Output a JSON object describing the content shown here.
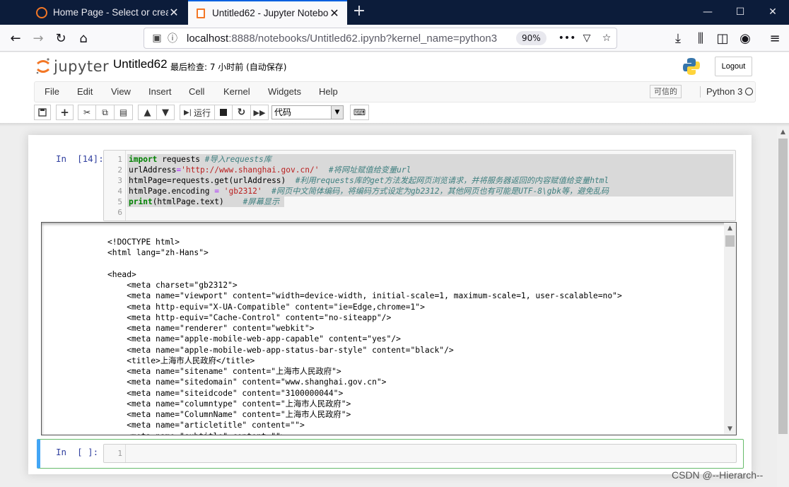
{
  "browser": {
    "tabs": [
      {
        "title": "Home Page - Select or create",
        "active": false,
        "icon": "jupyter-icon"
      },
      {
        "title": "Untitled62 - Jupyter Notebook",
        "active": true,
        "icon": "jupyter-icon"
      }
    ],
    "url_host": "localhost",
    "url_rest": ":8888/notebooks/Untitled62.ipynb?kernel_name=python3",
    "zoom": "90%"
  },
  "jupyter": {
    "logo_text": "jupyter",
    "notebook_title": "Untitled62",
    "checkpoint": "最后检查: 7 小时前  (自动保存)",
    "logout_label": "Logout",
    "menu": [
      "File",
      "Edit",
      "View",
      "Insert",
      "Cell",
      "Kernel",
      "Widgets",
      "Help"
    ],
    "trusted_label": "可信的",
    "kernel_name": "Python 3",
    "toolbar": {
      "run_label": "运行",
      "cell_type": "代码"
    }
  },
  "cell1": {
    "prompt": "In  [14]:",
    "line_numbers": [
      "1",
      "2",
      "3",
      "4",
      "5",
      "6"
    ]
  },
  "code": {
    "l1_kw": "import",
    "l1_mod": " requests ",
    "l1_cm": "#导入requests库",
    "l2_var": "urlAddress",
    "l2_eq": "=",
    "l2_str": "'http://www.shanghai.gov.cn/'",
    "l2_cm": "  #将网址赋值给变量url",
    "l3_code": "htmlPage=requests.get(urlAddress)",
    "l3_cm": "  #利用requests库的get方法发起网页浏览请求，并将服务器返回的内容赋值给变量html",
    "l4_code": "htmlPage.encoding ",
    "l4_eq": "=",
    "l4_str": " 'gb2312'",
    "l4_cm": "  #网页中文简体编码，将编码方式设定为gb2312，其他网页也有可能是UTF-8\\gbk等，避免乱码",
    "l5_kw": "print",
    "l5_code": "(htmlPage.text)",
    "l5_cm": "    #屏幕显示"
  },
  "output_lines": [
    "<!DOCTYPE html>",
    "<html lang=\"zh-Hans\">",
    "",
    "<head>",
    "    <meta charset=\"gb2312\">",
    "    <meta name=\"viewport\" content=\"width=device-width, initial-scale=1, maximum-scale=1, user-scalable=no\">",
    "    <meta http-equiv=\"X-UA-Compatible\" content=\"ie=Edge,chrome=1\">",
    "    <meta http-equiv=\"Cache-Control\" content=\"no-siteapp\"/>",
    "    <meta name=\"renderer\" content=\"webkit\">",
    "    <meta name=\"apple-mobile-web-app-capable\" content=\"yes\"/>",
    "    <meta name=\"apple-mobile-web-app-status-bar-style\" content=\"black\"/>",
    "    <title>上海市人民政府</title>",
    "    <meta name=\"sitename\" content=\"上海市人民政府\">",
    "    <meta name=\"sitedomain\" content=\"www.shanghai.gov.cn\">",
    "    <meta name=\"siteidcode\" content=\"3100000044\">",
    "    <meta name=\"columntype\" content=\"上海市人民政府\">",
    "    <meta name=\"ColumnName\" content=\"上海市人民政府\">",
    "    <meta name=\"articletitle\" content=\"\">",
    "    <meta name=\"subtitle\" content=\"\">"
  ],
  "cell2": {
    "prompt": "In  [ ]:",
    "line_number": "1"
  },
  "watermark": "CSDN @--Hierarch--"
}
